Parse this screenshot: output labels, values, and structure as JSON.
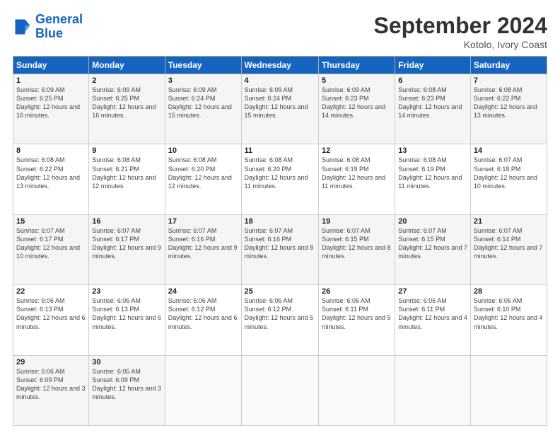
{
  "logo": {
    "line1": "General",
    "line2": "Blue"
  },
  "title": "September 2024",
  "subtitle": "Kotolo, Ivory Coast",
  "days_of_week": [
    "Sunday",
    "Monday",
    "Tuesday",
    "Wednesday",
    "Thursday",
    "Friday",
    "Saturday"
  ],
  "weeks": [
    [
      {
        "day": "1",
        "sunrise": "6:09 AM",
        "sunset": "6:25 PM",
        "daylight": "12 hours and 16 minutes."
      },
      {
        "day": "2",
        "sunrise": "6:09 AM",
        "sunset": "6:25 PM",
        "daylight": "12 hours and 16 minutes."
      },
      {
        "day": "3",
        "sunrise": "6:09 AM",
        "sunset": "6:24 PM",
        "daylight": "12 hours and 15 minutes."
      },
      {
        "day": "4",
        "sunrise": "6:09 AM",
        "sunset": "6:24 PM",
        "daylight": "12 hours and 15 minutes."
      },
      {
        "day": "5",
        "sunrise": "6:09 AM",
        "sunset": "6:23 PM",
        "daylight": "12 hours and 14 minutes."
      },
      {
        "day": "6",
        "sunrise": "6:08 AM",
        "sunset": "6:23 PM",
        "daylight": "12 hours and 14 minutes."
      },
      {
        "day": "7",
        "sunrise": "6:08 AM",
        "sunset": "6:22 PM",
        "daylight": "12 hours and 13 minutes."
      }
    ],
    [
      {
        "day": "8",
        "sunrise": "6:08 AM",
        "sunset": "6:22 PM",
        "daylight": "12 hours and 13 minutes."
      },
      {
        "day": "9",
        "sunrise": "6:08 AM",
        "sunset": "6:21 PM",
        "daylight": "12 hours and 12 minutes."
      },
      {
        "day": "10",
        "sunrise": "6:08 AM",
        "sunset": "6:20 PM",
        "daylight": "12 hours and 12 minutes."
      },
      {
        "day": "11",
        "sunrise": "6:08 AM",
        "sunset": "6:20 PM",
        "daylight": "12 hours and 11 minutes."
      },
      {
        "day": "12",
        "sunrise": "6:08 AM",
        "sunset": "6:19 PM",
        "daylight": "12 hours and 11 minutes."
      },
      {
        "day": "13",
        "sunrise": "6:08 AM",
        "sunset": "6:19 PM",
        "daylight": "12 hours and 11 minutes."
      },
      {
        "day": "14",
        "sunrise": "6:07 AM",
        "sunset": "6:18 PM",
        "daylight": "12 hours and 10 minutes."
      }
    ],
    [
      {
        "day": "15",
        "sunrise": "6:07 AM",
        "sunset": "6:17 PM",
        "daylight": "12 hours and 10 minutes."
      },
      {
        "day": "16",
        "sunrise": "6:07 AM",
        "sunset": "6:17 PM",
        "daylight": "12 hours and 9 minutes."
      },
      {
        "day": "17",
        "sunrise": "6:07 AM",
        "sunset": "6:16 PM",
        "daylight": "12 hours and 9 minutes."
      },
      {
        "day": "18",
        "sunrise": "6:07 AM",
        "sunset": "6:16 PM",
        "daylight": "12 hours and 8 minutes."
      },
      {
        "day": "19",
        "sunrise": "6:07 AM",
        "sunset": "6:15 PM",
        "daylight": "12 hours and 8 minutes."
      },
      {
        "day": "20",
        "sunrise": "6:07 AM",
        "sunset": "6:15 PM",
        "daylight": "12 hours and 7 minutes."
      },
      {
        "day": "21",
        "sunrise": "6:07 AM",
        "sunset": "6:14 PM",
        "daylight": "12 hours and 7 minutes."
      }
    ],
    [
      {
        "day": "22",
        "sunrise": "6:06 AM",
        "sunset": "6:13 PM",
        "daylight": "12 hours and 6 minutes."
      },
      {
        "day": "23",
        "sunrise": "6:06 AM",
        "sunset": "6:13 PM",
        "daylight": "12 hours and 6 minutes."
      },
      {
        "day": "24",
        "sunrise": "6:06 AM",
        "sunset": "6:12 PM",
        "daylight": "12 hours and 6 minutes."
      },
      {
        "day": "25",
        "sunrise": "6:06 AM",
        "sunset": "6:12 PM",
        "daylight": "12 hours and 5 minutes."
      },
      {
        "day": "26",
        "sunrise": "6:06 AM",
        "sunset": "6:11 PM",
        "daylight": "12 hours and 5 minutes."
      },
      {
        "day": "27",
        "sunrise": "6:06 AM",
        "sunset": "6:11 PM",
        "daylight": "12 hours and 4 minutes."
      },
      {
        "day": "28",
        "sunrise": "6:06 AM",
        "sunset": "6:10 PM",
        "daylight": "12 hours and 4 minutes."
      }
    ],
    [
      {
        "day": "29",
        "sunrise": "6:06 AM",
        "sunset": "6:09 PM",
        "daylight": "12 hours and 3 minutes."
      },
      {
        "day": "30",
        "sunrise": "6:05 AM",
        "sunset": "6:09 PM",
        "daylight": "12 hours and 3 minutes."
      },
      null,
      null,
      null,
      null,
      null
    ]
  ]
}
